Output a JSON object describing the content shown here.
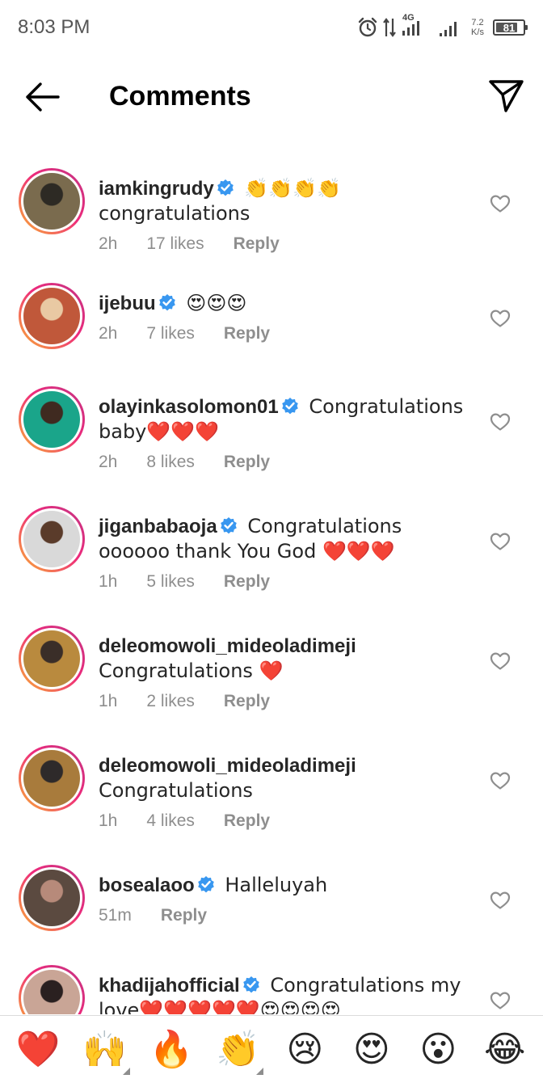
{
  "status_bar": {
    "time": "8:03 PM",
    "network": "4G",
    "speed_value": "7.2",
    "speed_unit": "K/s",
    "battery": "81",
    "battery_level": 0.81
  },
  "header": {
    "title": "Comments",
    "back_icon": "arrow-left-icon",
    "send_icon": "paper-plane-icon"
  },
  "comments": [
    {
      "username": "iamkingrudy",
      "verified": true,
      "text": "👏👏👏👏\ncongratulations",
      "time": "2h",
      "likes": "17 likes",
      "reply": "Reply",
      "avatar_colors": [
        "#7a6b4e",
        "#2d2a24"
      ]
    },
    {
      "username": "ijebuu",
      "verified": true,
      "text": "😍😍😍",
      "time": "2h",
      "likes": "7 likes",
      "reply": "Reply",
      "avatar_colors": [
        "#c0583a",
        "#e9c9a3"
      ]
    },
    {
      "username": "olayinkasolomon01",
      "verified": true,
      "text": "Congratulations baby❤️❤️❤️",
      "time": "2h",
      "likes": "8 likes",
      "reply": "Reply",
      "avatar_colors": [
        "#1aa58a",
        "#3f2a20"
      ]
    },
    {
      "username": "jiganbabaoja",
      "verified": true,
      "text": "Congratulations oooooo thank You God ❤️❤️❤️",
      "time": "1h",
      "likes": "5 likes",
      "reply": "Reply",
      "avatar_colors": [
        "#d9d9d9",
        "#5a3b2a"
      ]
    },
    {
      "username": "deleomowoli_mideoladimeji",
      "verified": false,
      "text": "Congratulations ❤️",
      "time": "1h",
      "likes": "2 likes",
      "reply": "Reply",
      "avatar_colors": [
        "#b98a3e",
        "#3a2e28"
      ]
    },
    {
      "username": "deleomowoli_mideoladimeji",
      "verified": false,
      "text": "Congratulations",
      "time": "1h",
      "likes": "4 likes",
      "reply": "Reply",
      "avatar_colors": [
        "#a87b3c",
        "#2e2a2a"
      ]
    },
    {
      "username": "bosealaoo",
      "verified": true,
      "text": "Halleluyah",
      "time": "51m",
      "likes": "",
      "reply": "Reply",
      "avatar_colors": [
        "#5b4a40",
        "#b78a7a"
      ]
    },
    {
      "username": "khadijahofficial",
      "verified": true,
      "text": "Congratulations my love❤️❤️❤️❤️❤️😍😍😍😍",
      "time": "",
      "likes": "",
      "reply": "",
      "avatar_colors": [
        "#c9a596",
        "#2a2020"
      ]
    }
  ],
  "emoji_bar": [
    "❤️",
    "🙌",
    "🔥",
    "👏",
    "😢",
    "😍",
    "😮",
    "😂"
  ],
  "colors": {
    "verified_blue": "#3897f0",
    "ring_gradient": [
      "#f9b233",
      "#ee2a7b",
      "#c13584"
    ],
    "meta_gray": "#8e8e8e"
  }
}
